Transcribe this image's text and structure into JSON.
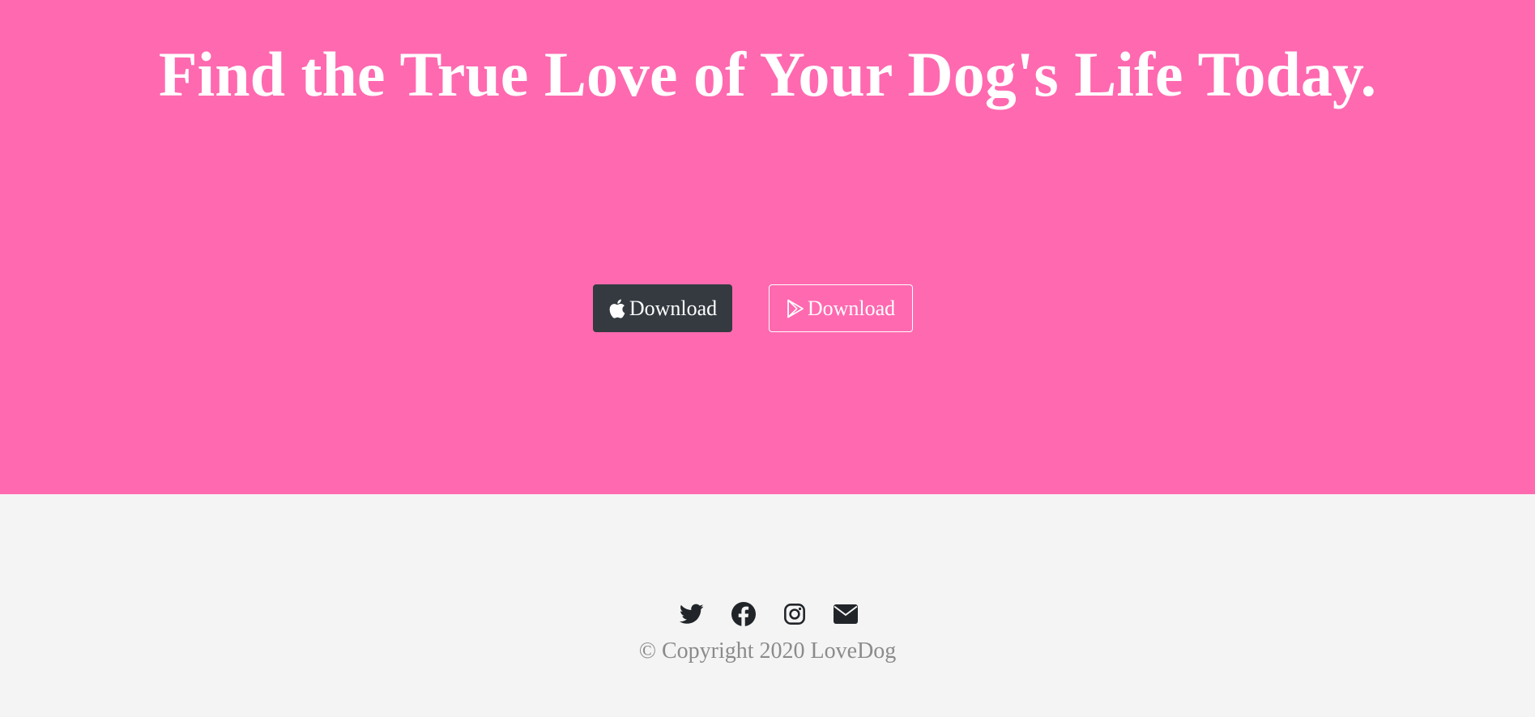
{
  "hero": {
    "title": "Find the True Love of Your Dog's Life Today.",
    "background_color": "#ff69b0",
    "buttons": [
      {
        "label": "Download",
        "icon": "apple-icon",
        "style": "dark",
        "color": "#343a40"
      },
      {
        "label": "Download",
        "icon": "google-play-icon",
        "style": "outline-light",
        "color": "#ffffff"
      }
    ]
  },
  "footer": {
    "background_color": "#f4f4f4",
    "social_icons": [
      "twitter-icon",
      "facebook-icon",
      "instagram-icon",
      "envelope-icon"
    ],
    "copyright": "© Copyright 2020 LoveDog"
  }
}
